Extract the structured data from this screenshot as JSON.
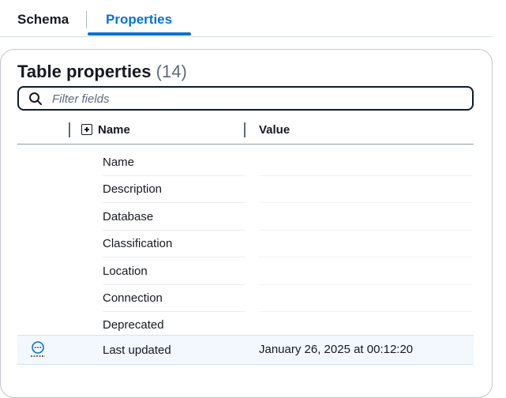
{
  "tabs": [
    {
      "label": "Schema",
      "active": false
    },
    {
      "label": "Properties",
      "active": true
    }
  ],
  "panel": {
    "title": "Table properties",
    "count": "(14)",
    "filter": {
      "placeholder": "Filter fields",
      "value": ""
    }
  },
  "table": {
    "columns": [
      "Name",
      "Value"
    ],
    "rows": [
      {
        "name": "Name",
        "value": ""
      },
      {
        "name": "Description",
        "value": ""
      },
      {
        "name": "Database",
        "value": ""
      },
      {
        "name": "Classification",
        "value": ""
      },
      {
        "name": "Location",
        "value": ""
      },
      {
        "name": "Connection",
        "value": ""
      },
      {
        "name": "Deprecated",
        "value": ""
      },
      {
        "name": "Last updated",
        "value": "January 26, 2025 at 00:12:20"
      }
    ]
  },
  "colors": {
    "accent": "#0972d3",
    "selected_row": "#f2f8fd"
  },
  "icons": {
    "filter": "search-icon",
    "expand": "expand-plus-icon",
    "row_action": "ellipsis-circle-icon"
  }
}
